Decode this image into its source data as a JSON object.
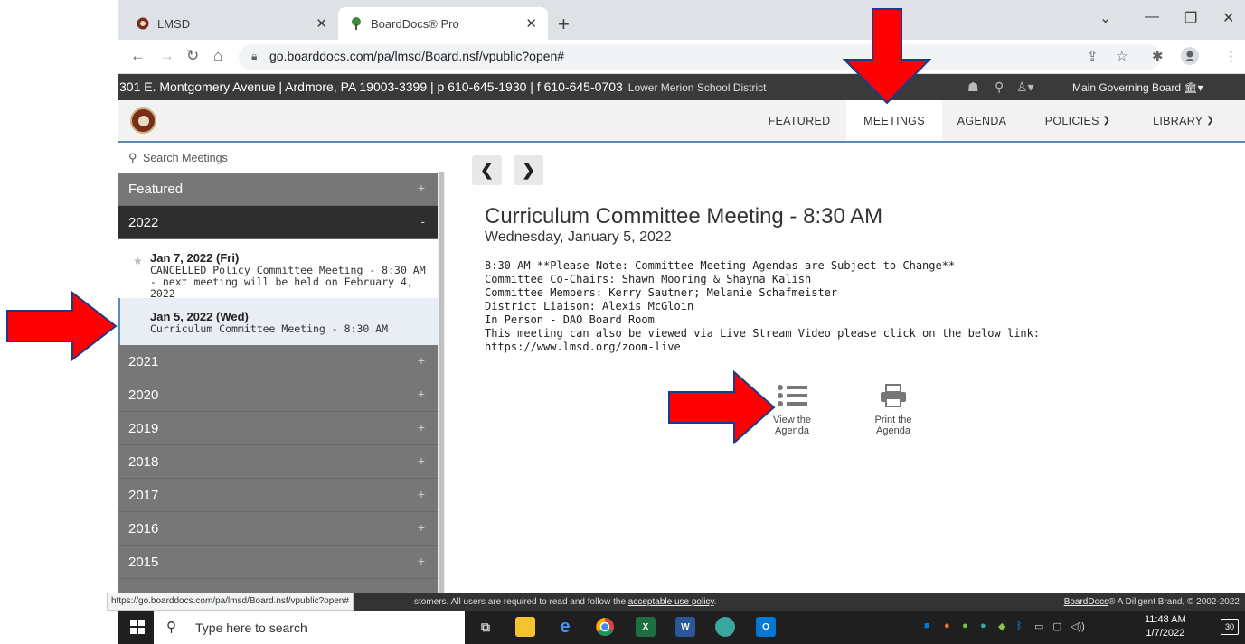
{
  "browser": {
    "tabs": [
      {
        "title": "LMSD",
        "active": false
      },
      {
        "title": "BoardDocs® Pro",
        "active": true
      }
    ],
    "new_tab": "+",
    "url": "go.boarddocs.com/pa/lmsd/Board.nsf/vpublic?open#"
  },
  "district_bar": {
    "address": "301 E. Montgomery Avenue | Ardmore, PA 19003-3399 | p 610-645-1930 | f 610-645-0703",
    "name": "Lower Merion School District",
    "board": "Main Governing Board"
  },
  "main_nav": {
    "items": [
      {
        "label": "FEATURED",
        "active": false
      },
      {
        "label": "MEETINGS",
        "active": true
      },
      {
        "label": "AGENDA",
        "active": false
      },
      {
        "label": "POLICIES",
        "active": false
      },
      {
        "label": "LIBRARY",
        "active": false
      }
    ]
  },
  "sidebar": {
    "search_placeholder": "Search Meetings",
    "groups": [
      {
        "label": "Featured",
        "toggle": "+"
      },
      {
        "label": "2022",
        "toggle": "-"
      },
      {
        "label": "2021",
        "toggle": "+"
      },
      {
        "label": "2020",
        "toggle": "+"
      },
      {
        "label": "2019",
        "toggle": "+"
      },
      {
        "label": "2018",
        "toggle": "+"
      },
      {
        "label": "2017",
        "toggle": "+"
      },
      {
        "label": "2016",
        "toggle": "+"
      },
      {
        "label": "2015",
        "toggle": "+"
      }
    ],
    "meetings": [
      {
        "date": "Jan 7, 2022 (Fri)",
        "title": "CANCELLED Policy Committee Meeting - 8:30 AM - next meeting will be held on February 4, 2022"
      },
      {
        "date": "Jan 5, 2022 (Wed)",
        "title": "Curriculum Committee Meeting - 8:30 AM"
      }
    ]
  },
  "meeting": {
    "title": "Curriculum Committee Meeting - 8:30 AM",
    "date": "Wednesday, January 5, 2022",
    "description": [
      "8:30 AM **Please Note: Committee Meeting Agendas are Subject to Change**",
      "Committee Co-Chairs: Shawn Mooring & Shayna Kalish",
      "Committee Members: Kerry Sautner; Melanie Schafmeister",
      "District Liaison: Alexis McGloin",
      "In Person - DAO Board Room",
      "This meeting can also be viewed via Live Stream Video please click on the below link:",
      "https://www.lmsd.org/zoom-live"
    ],
    "view_agenda": [
      "View the",
      "Agenda"
    ],
    "print_agenda": [
      "Print the",
      "Agenda"
    ]
  },
  "footer": {
    "text_start": "stomers. All users are required to read and follow the ",
    "link": "acceptable use policy",
    "text_end": ".",
    "right_link": "BoardDocs",
    "right_text": "® A Diligent Brand, © 2002-2022"
  },
  "status_url": "https://go.boarddocs.com/pa/lmsd/Board.nsf/vpublic?open#",
  "taskbar": {
    "search_placeholder": "Type here to search",
    "time": "11:48 AM",
    "date": "1/7/2022",
    "notifications": "30"
  },
  "colors": {
    "accent": "#5b8bb5",
    "sidebar_group": "#777777",
    "sidebar_open": "#2e2e2e",
    "annotation_arrow": "#ff0000"
  }
}
